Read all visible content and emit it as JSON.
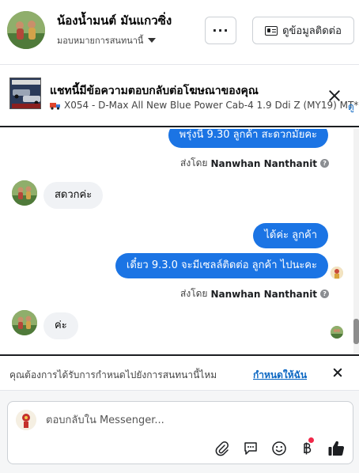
{
  "header": {
    "contact_name": "น้องน้ำมนต์ มันแกวซิ่ง",
    "assign_label": "มอบหมายการสนทนานี้",
    "more_label": "···",
    "info_button_label": "ดูข้อมูลติดต่อ"
  },
  "ad_banner": {
    "title": "แชทนี้มีข้อความตอบกลับต่อโฆษณาของคุณ",
    "subtitle": "X054 - D-Max All New Blue Power Cab-4 1.9 Ddi Z (MY19) MT*...",
    "link_text": "ดู",
    "subtitle_icon": "truck-icon"
  },
  "messages": [
    {
      "direction": "out",
      "text": "พรุ่งนี้ 9.30 ลูกค้า สะดวกมั้ยคะ"
    },
    {
      "type": "sent_by",
      "prefix": "ส่งโดย",
      "name": "Nanwhan Nanthanit"
    },
    {
      "direction": "in",
      "text": "สดวกค่ะ"
    },
    {
      "direction": "out",
      "text": "ได้ค่ะ  ลูกค้า"
    },
    {
      "direction": "out",
      "text": "เดี๋ยว 9.3.0 จะมีเซลล์ติดต่อ ลูกค้า ไปนะคะ"
    },
    {
      "type": "sent_by",
      "prefix": "ส่งโดย",
      "name": "Nanwhan Nanthanit"
    },
    {
      "direction": "in",
      "text": "ค่ะ"
    }
  ],
  "assign_prompt": {
    "text": "คุณต้องการได้รับการกำหนดไปยังการสนทนานี้ไหม",
    "link": "กำหนดให้ฉัน"
  },
  "composer": {
    "placeholder": "ตอบกลับใน Messenger...",
    "tools": [
      "paperclip-icon",
      "saved-reply-icon",
      "emoji-icon",
      "baht-icon",
      "like-icon"
    ]
  },
  "colors": {
    "outgoing_bubble": "#1b74e4",
    "incoming_bubble": "#f0f2f5",
    "link": "#0a66c2",
    "notification_dot": "#f02849"
  }
}
